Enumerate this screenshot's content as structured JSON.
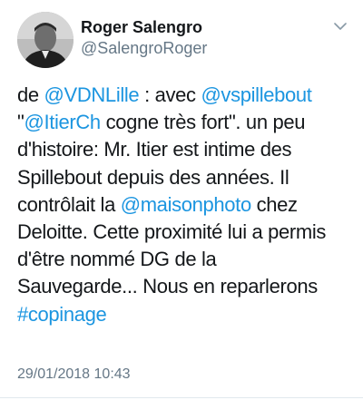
{
  "tweet": {
    "author": {
      "display_name": "Roger Salengro",
      "handle": "@SalengroRoger"
    },
    "menu_icon": "chevron-down-icon",
    "link_color": "#1b95e0",
    "lines": [
      [
        {
          "t": "de "
        },
        {
          "t": "@VDNLille",
          "link": true
        },
        {
          "t": " : avec "
        },
        {
          "t": "@vspillebout",
          "link": true
        }
      ],
      [
        {
          "t": "\""
        },
        {
          "t": "@ItierCh",
          "link": true
        },
        {
          "t": " cogne très fort\".  un peu"
        }
      ],
      [
        {
          "t": "d'histoire: Mr. Itier est intime des"
        }
      ],
      [
        {
          "t": "Spillebout depuis des années. Il"
        }
      ],
      [
        {
          "t": "contrôlait la "
        },
        {
          "t": "@maisonphoto",
          "link": true
        },
        {
          "t": " chez"
        }
      ],
      [
        {
          "t": "Deloitte. Cette proximité lui a permis"
        }
      ],
      [
        {
          "t": "d'être nommé DG de la"
        }
      ],
      [
        {
          "t": "Sauvegarde... Nous en reparlerons"
        }
      ],
      [
        {
          "t": "#copinage",
          "link": true
        }
      ]
    ],
    "timestamp": "29/01/2018 10:43"
  }
}
